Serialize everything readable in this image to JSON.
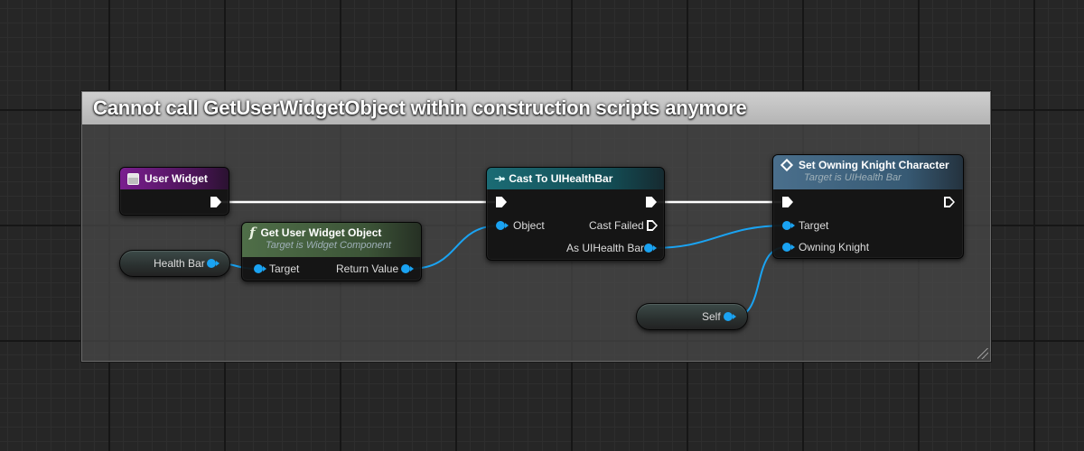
{
  "comment": {
    "title": "Cannot call GetUserWidgetObject within construction scripts anymore"
  },
  "nodes": {
    "user_widget": {
      "title": "User Widget",
      "icon": "widget-icon",
      "color": "#7a1e8f"
    },
    "get_user_widget_object": {
      "title": "Get User Widget Object",
      "subtitle": "Target is Widget Component",
      "icon": "function-icon",
      "color": "#4f6e48",
      "pins": {
        "target": "Target",
        "return_value": "Return Value"
      }
    },
    "cast_to_uihealthbar": {
      "title": "Cast To UIHealthBar",
      "icon": "cast-icon",
      "color": "#1b6b74",
      "pins": {
        "object": "Object",
        "cast_failed": "Cast Failed",
        "as_uihealthbar": "As UIHealth Bar"
      }
    },
    "set_owning_knight": {
      "title": "Set Owning Knight Character",
      "subtitle": "Target is UIHealth Bar",
      "icon": "diamond-icon",
      "color": "#4a6f8c",
      "pins": {
        "target": "Target",
        "owning_knight": "Owning Knight"
      }
    }
  },
  "variables": {
    "health_bar": "Health Bar",
    "self": "Self"
  },
  "colors": {
    "exec_wire": "#ffffff",
    "object_wire": "#1aa3f2"
  }
}
